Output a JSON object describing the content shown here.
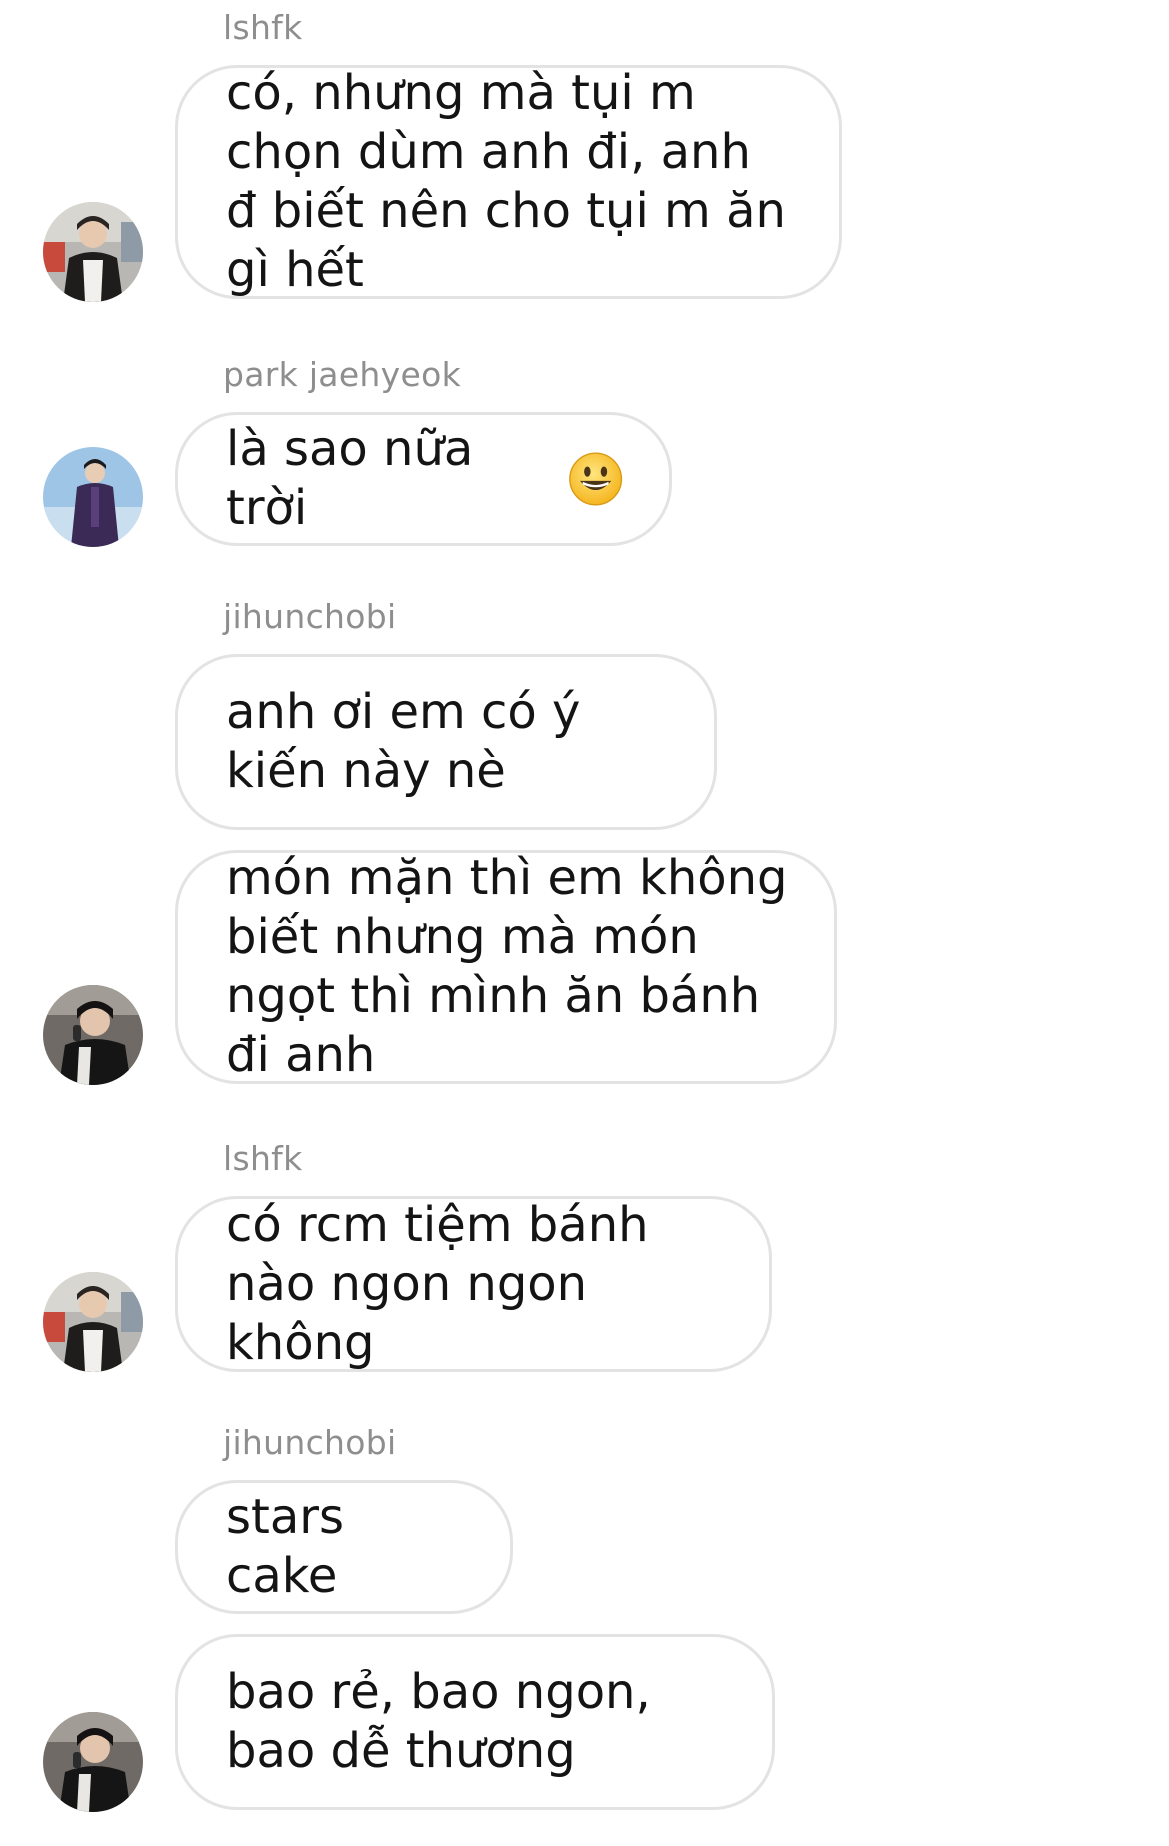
{
  "conversation": {
    "messages": [
      {
        "sender": "lshfk",
        "text": "có, nhưng mà tụi m chọn dùm anh đi, anh đ biết nên cho tụi m ăn gì hết"
      },
      {
        "sender": "park jaehyeok",
        "text": "là sao nữa trời",
        "emoji": "grinning-face-emoji"
      },
      {
        "sender": "jihunchobi",
        "text": "anh ơi em có ý kiến này nè"
      },
      {
        "text": "món mặn thì em không biết nhưng mà món ngọt thì mình ăn bánh đi anh"
      },
      {
        "sender": "lshfk",
        "text": "có rcm tiệm bánh nào ngon ngon không"
      },
      {
        "sender": "jihunchobi",
        "text": "stars cake"
      },
      {
        "text": "bao rẻ, bao ngon, bao dễ thương"
      }
    ]
  },
  "colors": {
    "background": "#ffffff",
    "bubble_border": "#e3e3e3",
    "message_text": "#141414",
    "sender_text": "#8e8e8e"
  }
}
